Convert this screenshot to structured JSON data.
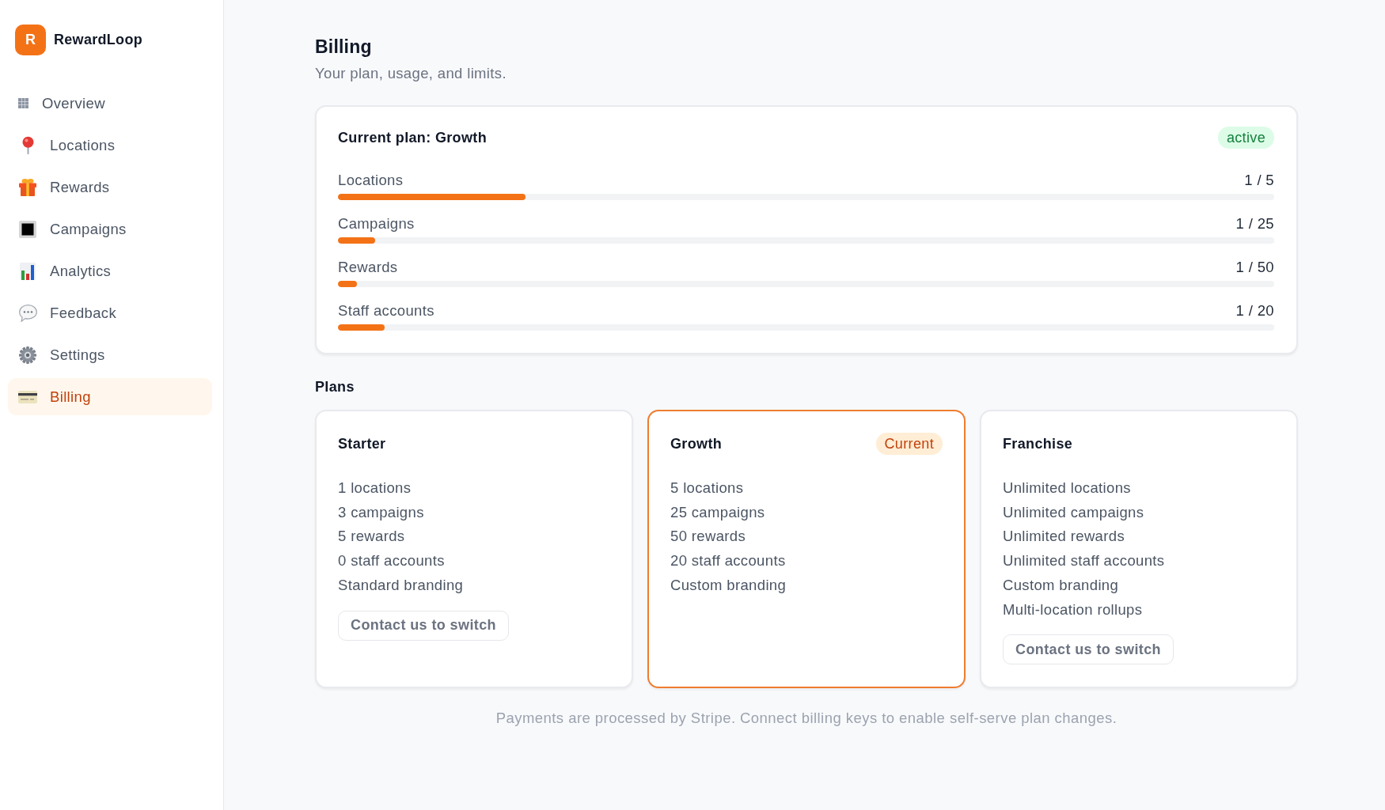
{
  "sidebar": {
    "brand": {
      "logo_letter": "R",
      "name": "RewardLoop"
    },
    "items": [
      {
        "label": "Overview",
        "selected": false
      },
      {
        "label": "Locations",
        "selected": false
      },
      {
        "label": "Rewards",
        "selected": false
      },
      {
        "label": "Campaigns",
        "selected": false
      },
      {
        "label": "Analytics",
        "selected": false
      },
      {
        "label": "Feedback",
        "selected": false
      },
      {
        "label": "Settings",
        "selected": false
      },
      {
        "label": "Billing",
        "selected": true
      }
    ]
  },
  "header": {
    "title": "Billing",
    "subtitle": "Your plan, usage, and limits."
  },
  "current_plan": {
    "title": "Current plan: Growth",
    "status": "active",
    "usage": [
      {
        "label": "Locations",
        "reading": "1 / 5",
        "level": 0.2
      },
      {
        "label": "Campaigns",
        "reading": "1 / 25",
        "level": 0.04
      },
      {
        "label": "Rewards",
        "reading": "1 / 50",
        "level": 0.02
      },
      {
        "label": "Staff accounts",
        "reading": "1 / 20",
        "level": 0.05
      }
    ]
  },
  "plans": {
    "heading": "Plans",
    "items": [
      {
        "name": "Starter",
        "current": false,
        "features": [
          "1 locations",
          "3 campaigns",
          "5 rewards",
          "0 staff accounts",
          "Standard branding"
        ],
        "button": "Contact us to switch"
      },
      {
        "name": "Growth",
        "current": true,
        "badge": "Current",
        "features": [
          "5 locations",
          "25 campaigns",
          "50 rewards",
          "20 staff accounts",
          "Custom branding"
        ]
      },
      {
        "name": "Franchise",
        "current": false,
        "features": [
          "Unlimited locations",
          "Unlimited campaigns",
          "Unlimited rewards",
          "Unlimited staff accounts",
          "Custom branding",
          "Multi-location rollups"
        ],
        "button": "Contact us to switch"
      }
    ]
  },
  "footer_note": "Payments are processed by Stripe. Connect billing keys to enable self-serve plan changes."
}
